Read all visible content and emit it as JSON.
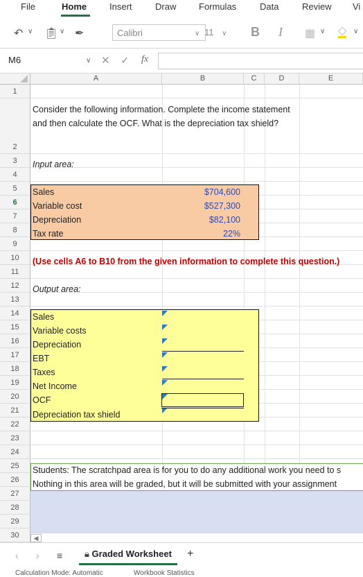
{
  "ribbon": {
    "tabs": [
      "File",
      "Home",
      "Insert",
      "Draw",
      "Formulas",
      "Data",
      "Review",
      "Vi"
    ],
    "active_tab": "Home",
    "font_name": "Calibri",
    "font_size": "11",
    "bold_label": "B",
    "italic_label": "I"
  },
  "formula_bar": {
    "name_box": "M6",
    "fx_label": "fx",
    "formula": ""
  },
  "columns": [
    "A",
    "B",
    "C",
    "D",
    "E"
  ],
  "rows": [
    "1",
    "2",
    "3",
    "4",
    "5",
    "6",
    "7",
    "8",
    "9",
    "10",
    "11",
    "12",
    "13",
    "14",
    "15",
    "16",
    "17",
    "18",
    "19",
    "20",
    "21",
    "22",
    "23",
    "24",
    "25",
    "26",
    "27",
    "28",
    "29",
    "30"
  ],
  "sheet": {
    "question": "Consider the following information. Complete the income statement and then calculate the OCF. What is the depreciation tax shield?",
    "input_label": "Input area:",
    "inputs": [
      {
        "label": "Sales",
        "value": "$704,600"
      },
      {
        "label": "Variable cost",
        "value": "$527,300"
      },
      {
        "label": "Depreciation",
        "value": "$82,100"
      },
      {
        "label": "Tax rate",
        "value": "22%"
      }
    ],
    "instruction": "(Use cells A6 to B10 from the given information to complete this question.)",
    "output_label": "Output area:",
    "outputs": [
      "Sales",
      "Variable costs",
      "Depreciation",
      "EBT",
      "Taxes",
      "Net Income",
      "OCF",
      "Depreciation tax shield"
    ],
    "scratch_line1": "Students: The scratchpad area is for you to do any additional work you need to s",
    "scratch_line2": "Nothing in this area will be graded, but it will be submitted with your assignment"
  },
  "sheet_tabs": {
    "active": "Graded Worksheet",
    "add": "+"
  },
  "status": {
    "calc_mode": "Calculation Mode: Automatic",
    "stats": "Workbook Statistics"
  },
  "colors": {
    "input_fill": "#f8cba4",
    "output_fill": "#ffff99",
    "scratch_fill": "#d9dff2",
    "accent": "#217346",
    "scratch_border": "#6aa84f"
  }
}
